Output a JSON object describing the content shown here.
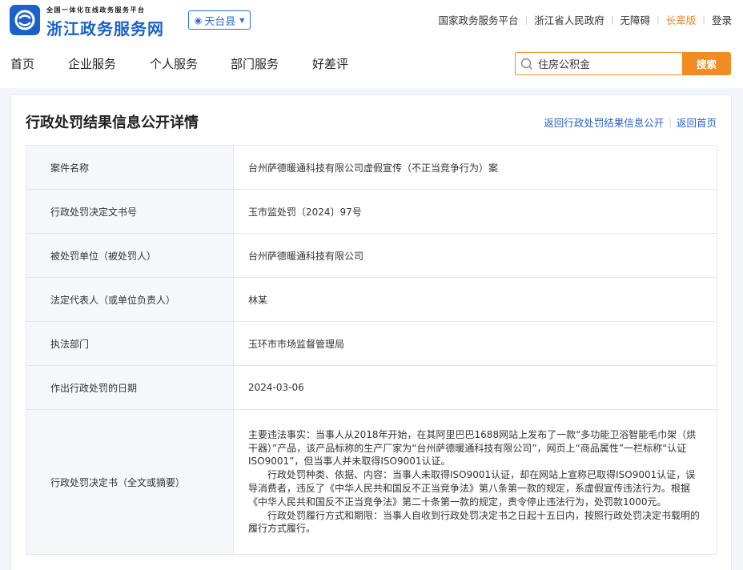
{
  "header": {
    "logo_sub": "全国一体化在线政务服务平台",
    "logo_main": "浙江政务服务网",
    "region": "天台县",
    "top_links": [
      "国家政务服务平台",
      "浙江省人民政府",
      "无障碍",
      "长辈版",
      "登录"
    ]
  },
  "nav": {
    "items": [
      "首页",
      "企业服务",
      "个人服务",
      "部门服务",
      "好差评"
    ]
  },
  "search": {
    "value": "住房公积金",
    "button_label": "搜索"
  },
  "page": {
    "title": "行政处罚结果信息公开详情",
    "links": [
      "返回行政处罚结果信息公开",
      "返回首页"
    ]
  },
  "details": [
    {
      "label": "案件名称",
      "value": "台州萨德暖通科技有限公司虚假宣传（不正当竞争行为）案"
    },
    {
      "label": "行政处罚决定文书号",
      "value": "玉市监处罚〔2024〕97号"
    },
    {
      "label": "被处罚单位（被处罚人）",
      "value": "台州萨德暖通科技有限公司"
    },
    {
      "label": "法定代表人（或单位负责人）",
      "value": "林某"
    },
    {
      "label": "执法部门",
      "value": "玉环市市场监督管理局"
    },
    {
      "label": "作出行政处罚的日期",
      "value": "2024-03-06"
    }
  ],
  "decision": {
    "label": "行政处罚决定书（全文或摘要）",
    "paragraphs": [
      "主要违法事实：当事人从2018年开始，在其阿里巴巴1688网站上发布了一款“多功能卫浴智能毛巾架（烘干器）”产品，该产品标称的生产厂家为“台州萨德暖通科技有限公司”，网页上“商品属性”一栏标称“认证ISO9001”，但当事人并未取得ISO9001认证。",
      "行政处罚种类、依据、内容：当事人未取得ISO9001认证，却在网站上宣称已取得ISO9001认证，误导消费者，违反了《中华人民共和国反不正当竞争法》第八条第一款的规定，系虚假宣传违法行为。根据《中华人民共和国反不正当竞争法》第二十条第一款的规定，责令停止违法行为，处罚款1000元。",
      "行政处罚履行方式和期限：当事人自收到行政处罚决定书之日起十五日内，按照行政处罚决定书载明的履行方式履行。"
    ]
  },
  "colors": {
    "brand_blue": "#1a62c9",
    "link_blue": "#2a62c6",
    "accent_orange": "#f08c22"
  }
}
